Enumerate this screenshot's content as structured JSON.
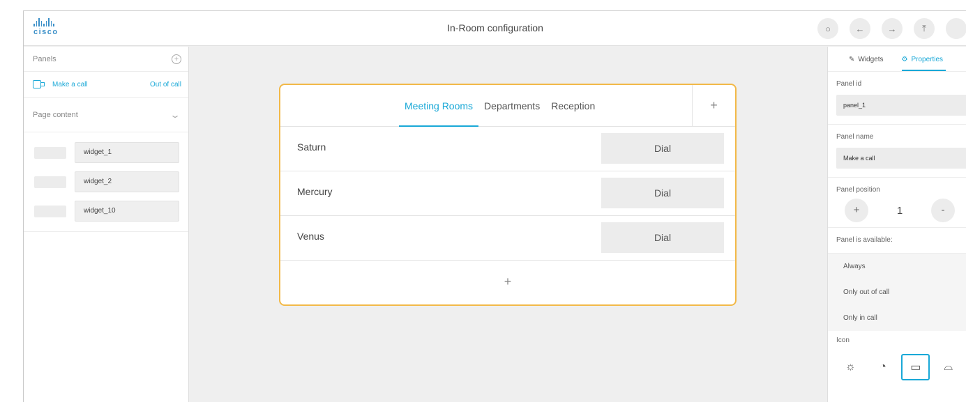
{
  "brand": {
    "logo_text": "cisco"
  },
  "header": {
    "title": "In-Room configuration",
    "buttons": [
      {
        "name": "preview",
        "glyph": "○"
      },
      {
        "name": "undo",
        "glyph": "←"
      },
      {
        "name": "redo",
        "glyph": "→"
      },
      {
        "name": "upload",
        "glyph": "⤒"
      }
    ]
  },
  "left_panel": {
    "panels_title": "Panels",
    "panel": {
      "name": "Make a call",
      "status": "Out of call"
    },
    "page_content_title": "Page content",
    "widgets": [
      "widget_1",
      "widget_2",
      "widget_10"
    ]
  },
  "preview": {
    "tabs": [
      "Meeting Rooms",
      "Departments",
      "Reception"
    ],
    "active_tab": "Meeting Rooms",
    "add_tab": "+",
    "rows": [
      {
        "name": "Saturn",
        "button": "Dial"
      },
      {
        "name": "Mercury",
        "button": "Dial"
      },
      {
        "name": "Venus",
        "button": "Dial"
      }
    ],
    "add_row": "+"
  },
  "right_panel": {
    "tabs": {
      "widgets": "Widgets",
      "properties": "Properties"
    },
    "panel_id_label": "Panel id",
    "panel_id_value": "panel_1",
    "panel_name_label": "Panel name",
    "panel_name_value": "Make a call",
    "panel_position_label": "Panel position",
    "panel_position_value": "1",
    "position_plus": "+",
    "position_minus": "-",
    "availability_label": "Panel is available:",
    "availability_options": [
      "Always",
      "Only out of call",
      "Only in call"
    ],
    "icon_label": "Icon"
  },
  "colors": {
    "accent": "#19a8d7",
    "highlight_border": "#f2b948"
  }
}
